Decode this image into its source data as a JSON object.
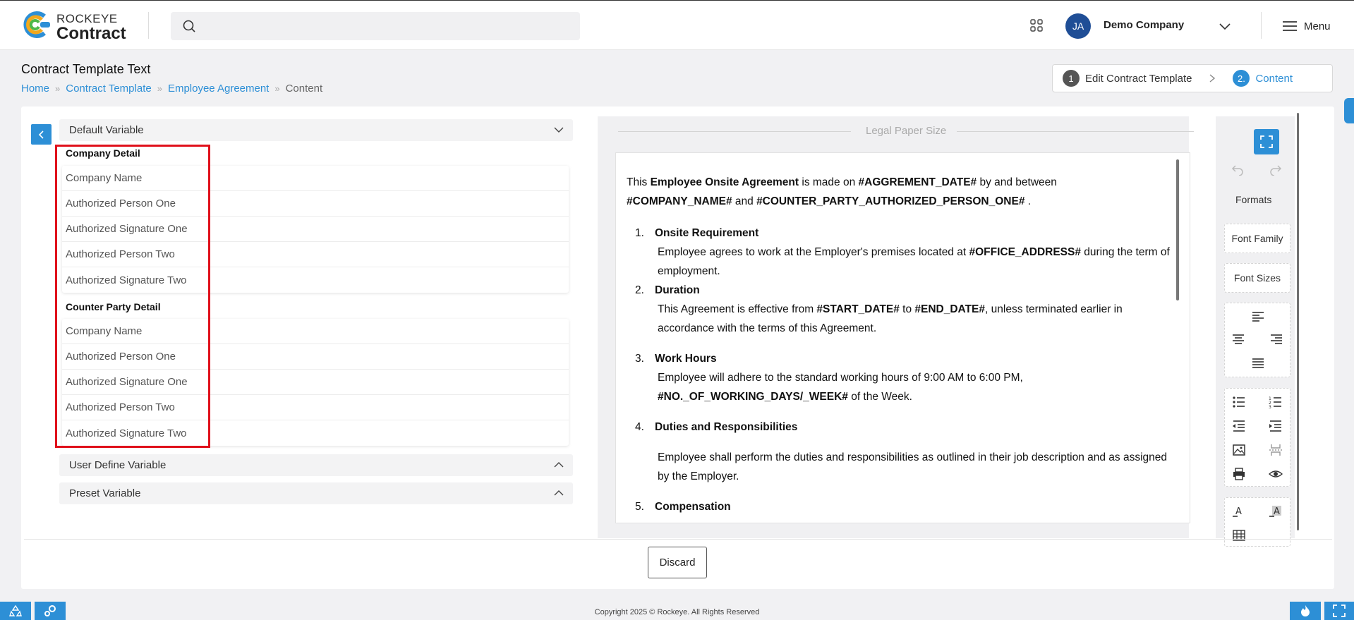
{
  "header": {
    "brand_top": "ROCKEYE",
    "brand_bottom": "Contract",
    "search_placeholder": "",
    "avatar_initials": "JA",
    "company_name": "Demo Company",
    "menu_label": "Menu"
  },
  "page": {
    "title": "Contract Template Text",
    "breadcrumb": [
      "Home",
      "Contract Template",
      "Employee Agreement",
      "Content"
    ]
  },
  "stepper": {
    "steps": [
      {
        "number": "1",
        "label": "Edit Contract Template"
      },
      {
        "number": "2.",
        "label": "Content"
      }
    ]
  },
  "variables": {
    "default_header": "Default Variable",
    "groups": [
      {
        "title": "Company Detail",
        "items": [
          "Company Name",
          "Authorized Person One",
          "Authorized Signature One",
          "Authorized Person Two",
          "Authorized Signature Two"
        ]
      },
      {
        "title": "Counter Party Detail",
        "items": [
          "Company Name",
          "Authorized Person One",
          "Authorized Signature One",
          "Authorized Person Two",
          "Authorized Signature Two"
        ]
      }
    ],
    "user_define_header": "User Define Variable",
    "preset_header": "Preset Variable"
  },
  "editor": {
    "paper_size_label": "Legal Paper Size",
    "intro": {
      "t1": "This ",
      "b1": "Employee Onsite Agreement",
      "t2": " is made on ",
      "b2": "#AGGREMENT_DATE#",
      "t3": "  by and between",
      "b3": " #COMPANY_NAME#",
      "t4": " and ",
      "b4": " #COUNTER_PARTY_AUTHORIZED_PERSON_ONE#",
      "t5": " ."
    },
    "s1": {
      "num": "1.",
      "title": "Onsite Requirement",
      "t1": "Employee agrees to work at the Employer's premises located at ",
      "b1": " #OFFICE_ADDRESS#",
      "t2": " during the term of employment."
    },
    "s2": {
      "num": "2.",
      "title": "Duration",
      "t1": "This Agreement is effective from ",
      "b1": " #START_DATE#",
      "t2": " to ",
      "b2": " #END_DATE#",
      "t3": ", unless terminated earlier in accordance with the terms of this Agreement."
    },
    "s3": {
      "num": "3.",
      "title": "Work Hours",
      "t1": "Employee will adhere to the standard working hours of 9:00 AM to 6:00 PM,",
      "b1": " #NO._OF_WORKING_DAYS/_WEEK#",
      "t2": " of the Week."
    },
    "s4": {
      "num": "4.",
      "title": "Duties and Responsibilities",
      "t1": "Employee shall perform the duties and responsibilities as outlined in their job description and as assigned by the Employer."
    },
    "s5": {
      "num": "5.",
      "title": "Compensation"
    }
  },
  "toolbar": {
    "formats_label": "Formats",
    "font_family_label": "Font Family",
    "font_sizes_label": "Font Sizes"
  },
  "actions": {
    "discard_label": "Discard"
  },
  "footer": {
    "copyright": "Copyright 2025 © Rockeye. All Rights Reserved"
  },
  "colors": {
    "accent": "#2d8fd6",
    "highlight": "#e0101b",
    "avatar": "#1f4e96"
  }
}
